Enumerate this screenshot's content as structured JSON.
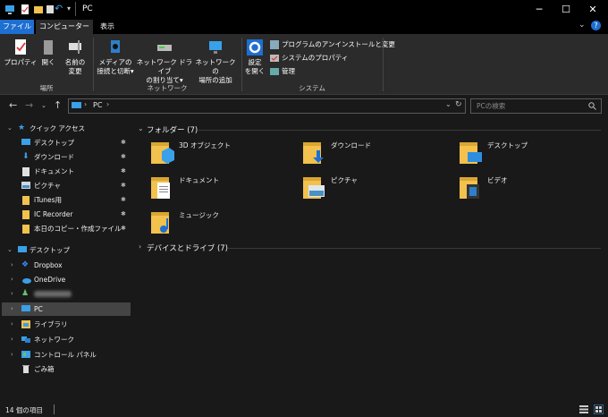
{
  "window": {
    "title": "PC"
  },
  "colors": {
    "accent": "#1e6fd1",
    "folder": "#f2c14e",
    "folder_dark": "#d9a632",
    "bg": "#191919",
    "ribbon": "#2b2b2b"
  },
  "tabs": {
    "file": "ファイル",
    "computer": "コンピューター",
    "view": "表示"
  },
  "ribbon": {
    "location_group": "場所",
    "properties": "プロパティ",
    "open": "開く",
    "rename_1": "名前の",
    "rename_2": "変更",
    "network_group": "ネットワーク",
    "media_1": "メディアの",
    "media_2": "接続と切断▾",
    "mapdrive_1": "ネットワーク ドライブ",
    "mapdrive_2": "の割り当て▾",
    "netloc_1": "ネットワークの",
    "netloc_2": "場所の追加",
    "system_group": "システム",
    "settings_1": "設定",
    "settings_2": "を開く",
    "uninstall": "プログラムのアンインストールと変更",
    "sysprops": "システムのプロパティ",
    "manage": "管理"
  },
  "address": {
    "path": "PC",
    "search_placeholder": "PCの検索"
  },
  "nav": {
    "quick_access": "クイック アクセス",
    "desktop": "デスクトップ",
    "downloads": "ダウンロード",
    "documents": "ドキュメント",
    "pictures": "ピクチャ",
    "itunes": "iTunes用",
    "ic_recorder": "IC Recorder",
    "today_copy": "本日のコピー・作成ファイル",
    "desktop_root": "デスクトップ",
    "dropbox": "Dropbox",
    "onedrive": "OneDrive",
    "pc": "PC",
    "libraries": "ライブラリ",
    "network": "ネットワーク",
    "control_panel": "コントロール パネル",
    "recycle_bin": "ごみ箱"
  },
  "content": {
    "folders_header": "フォルダー (7)",
    "devices_header": "デバイスとドライブ (7)",
    "folders": [
      "3D オブジェクト",
      "ダウンロード",
      "デスクトップ",
      "ドキュメント",
      "ピクチャ",
      "ビデオ",
      "ミュージック"
    ]
  },
  "status": {
    "count": "14 個の項目"
  }
}
